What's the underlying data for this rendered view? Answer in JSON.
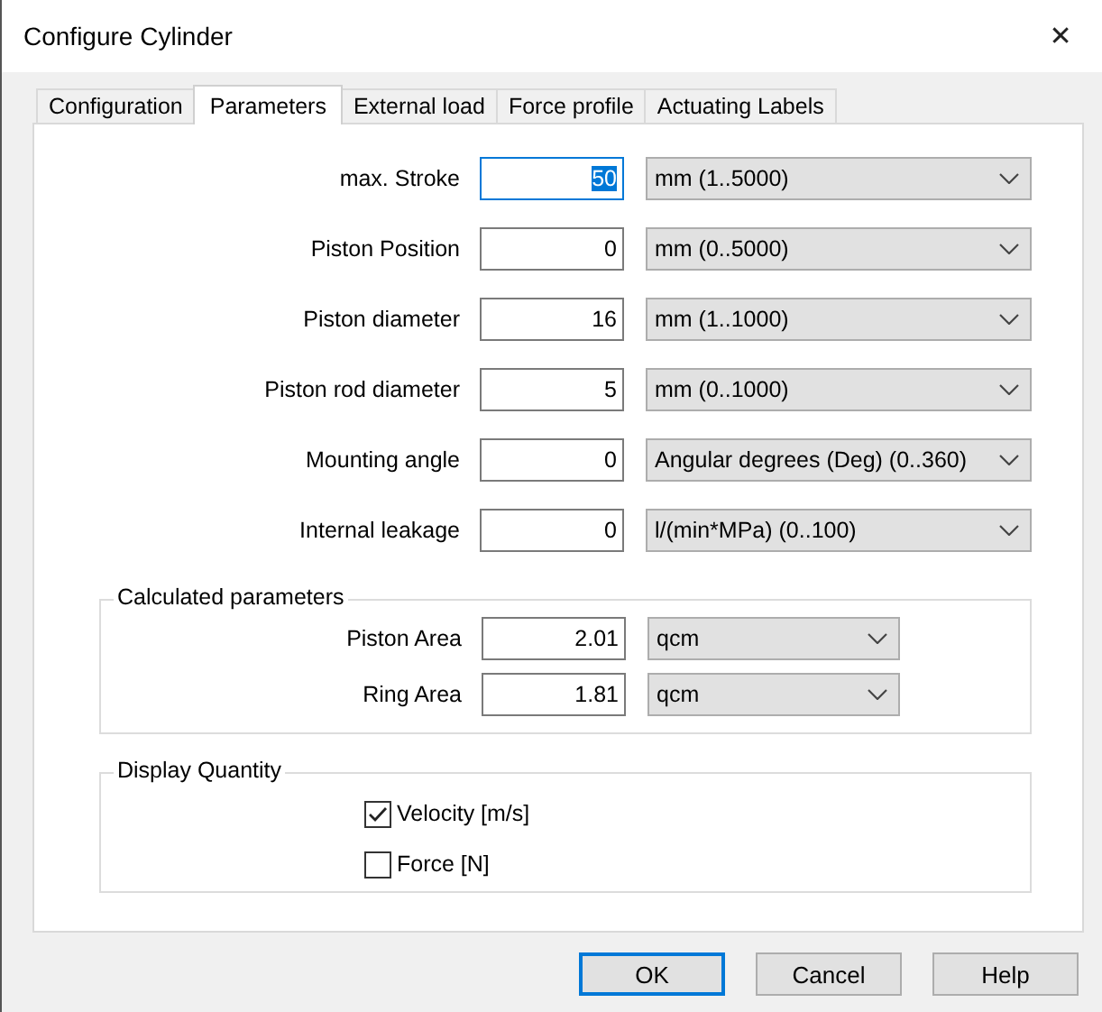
{
  "window": {
    "title": "Configure Cylinder",
    "close": "✕"
  },
  "tabs": [
    {
      "label": "Configuration",
      "selected": false
    },
    {
      "label": "Parameters",
      "selected": true
    },
    {
      "label": "External load",
      "selected": false
    },
    {
      "label": "Force profile",
      "selected": false
    },
    {
      "label": "Actuating Labels",
      "selected": false
    }
  ],
  "parameters": [
    {
      "label": "max. Stroke",
      "value": "50",
      "focused": true,
      "unit": "mm  (1..5000)"
    },
    {
      "label": "Piston Position",
      "value": "0",
      "focused": false,
      "unit": "mm  (0..5000)"
    },
    {
      "label": "Piston diameter",
      "value": "16",
      "focused": false,
      "unit": "mm  (1..1000)"
    },
    {
      "label": "Piston rod diameter",
      "value": "5",
      "focused": false,
      "unit": "mm  (0..1000)"
    },
    {
      "label": "Mounting angle",
      "value": "0",
      "focused": false,
      "unit": "Angular degrees (Deg)  (0..360)"
    },
    {
      "label": "Internal leakage",
      "value": "0",
      "focused": false,
      "unit": "l/(min*MPa)  (0..100)"
    }
  ],
  "calculated": {
    "title": "Calculated parameters",
    "rows": [
      {
        "label": "Piston Area",
        "value": "2.01",
        "unit": "qcm"
      },
      {
        "label": "Ring Area",
        "value": "1.81",
        "unit": "qcm"
      }
    ]
  },
  "display_quantity": {
    "title": "Display Quantity",
    "options": [
      {
        "label": "Velocity [m/s]",
        "checked": true
      },
      {
        "label": "Force [N]",
        "checked": false
      }
    ]
  },
  "buttons": [
    {
      "label": "OK",
      "default": true
    },
    {
      "label": "Cancel",
      "default": false
    },
    {
      "label": "Help",
      "default": false
    }
  ]
}
